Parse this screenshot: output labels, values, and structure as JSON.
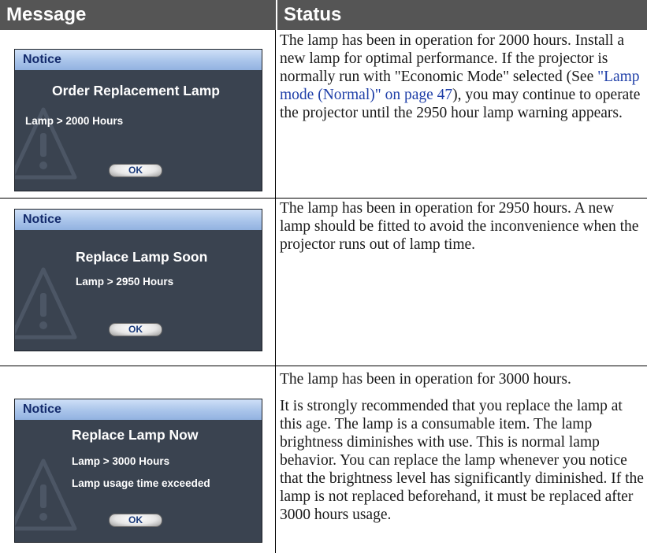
{
  "header": {
    "message": "Message",
    "status": "Status"
  },
  "rows": [
    {
      "notice": {
        "title": "Notice",
        "heading": "Order Replacement Lamp",
        "line1": "Lamp > 2000 Hours",
        "line2": "",
        "ok": "OK"
      },
      "status": {
        "p1_before": "The lamp has been in operation for 2000 hours. Install a new lamp for optimal performance. If the projector is normally run with \"Economic Mode\" selected (See ",
        "p1_link": "\"Lamp mode (Normal)\" on page 47",
        "p1_after": "), you may continue to operate the projector until the 2950 hour lamp warning appears."
      }
    },
    {
      "notice": {
        "title": "Notice",
        "heading": "Replace Lamp Soon",
        "line1": "Lamp > 2950 Hours",
        "line2": "",
        "ok": "OK"
      },
      "status": {
        "p1": "The lamp has been in operation for 2950 hours. A new lamp should be fitted to avoid the inconvenience when the projector runs out of lamp time."
      }
    },
    {
      "notice": {
        "title": "Notice",
        "heading": "Replace Lamp Now",
        "line1": "Lamp > 3000 Hours",
        "line2": "Lamp usage time exceeded",
        "ok": "OK"
      },
      "status": {
        "p1": "The lamp has been in operation for 3000 hours.",
        "p2": "It is strongly recommended that you replace the lamp at this age. The lamp is a consumable item. The lamp brightness diminishes with use. This is normal lamp behavior. You can replace the lamp whenever you notice that the brightness level has significantly diminished. If the lamp is not replaced beforehand, it must be replaced after 3000 hours usage."
      }
    }
  ],
  "icons": {
    "warning": "warning-triangle-icon"
  },
  "colors": {
    "header_bg": "#555555",
    "notice_bg": "#3a4350",
    "notice_title_bg": "#a9c4ea",
    "link": "#1f3fa8"
  }
}
